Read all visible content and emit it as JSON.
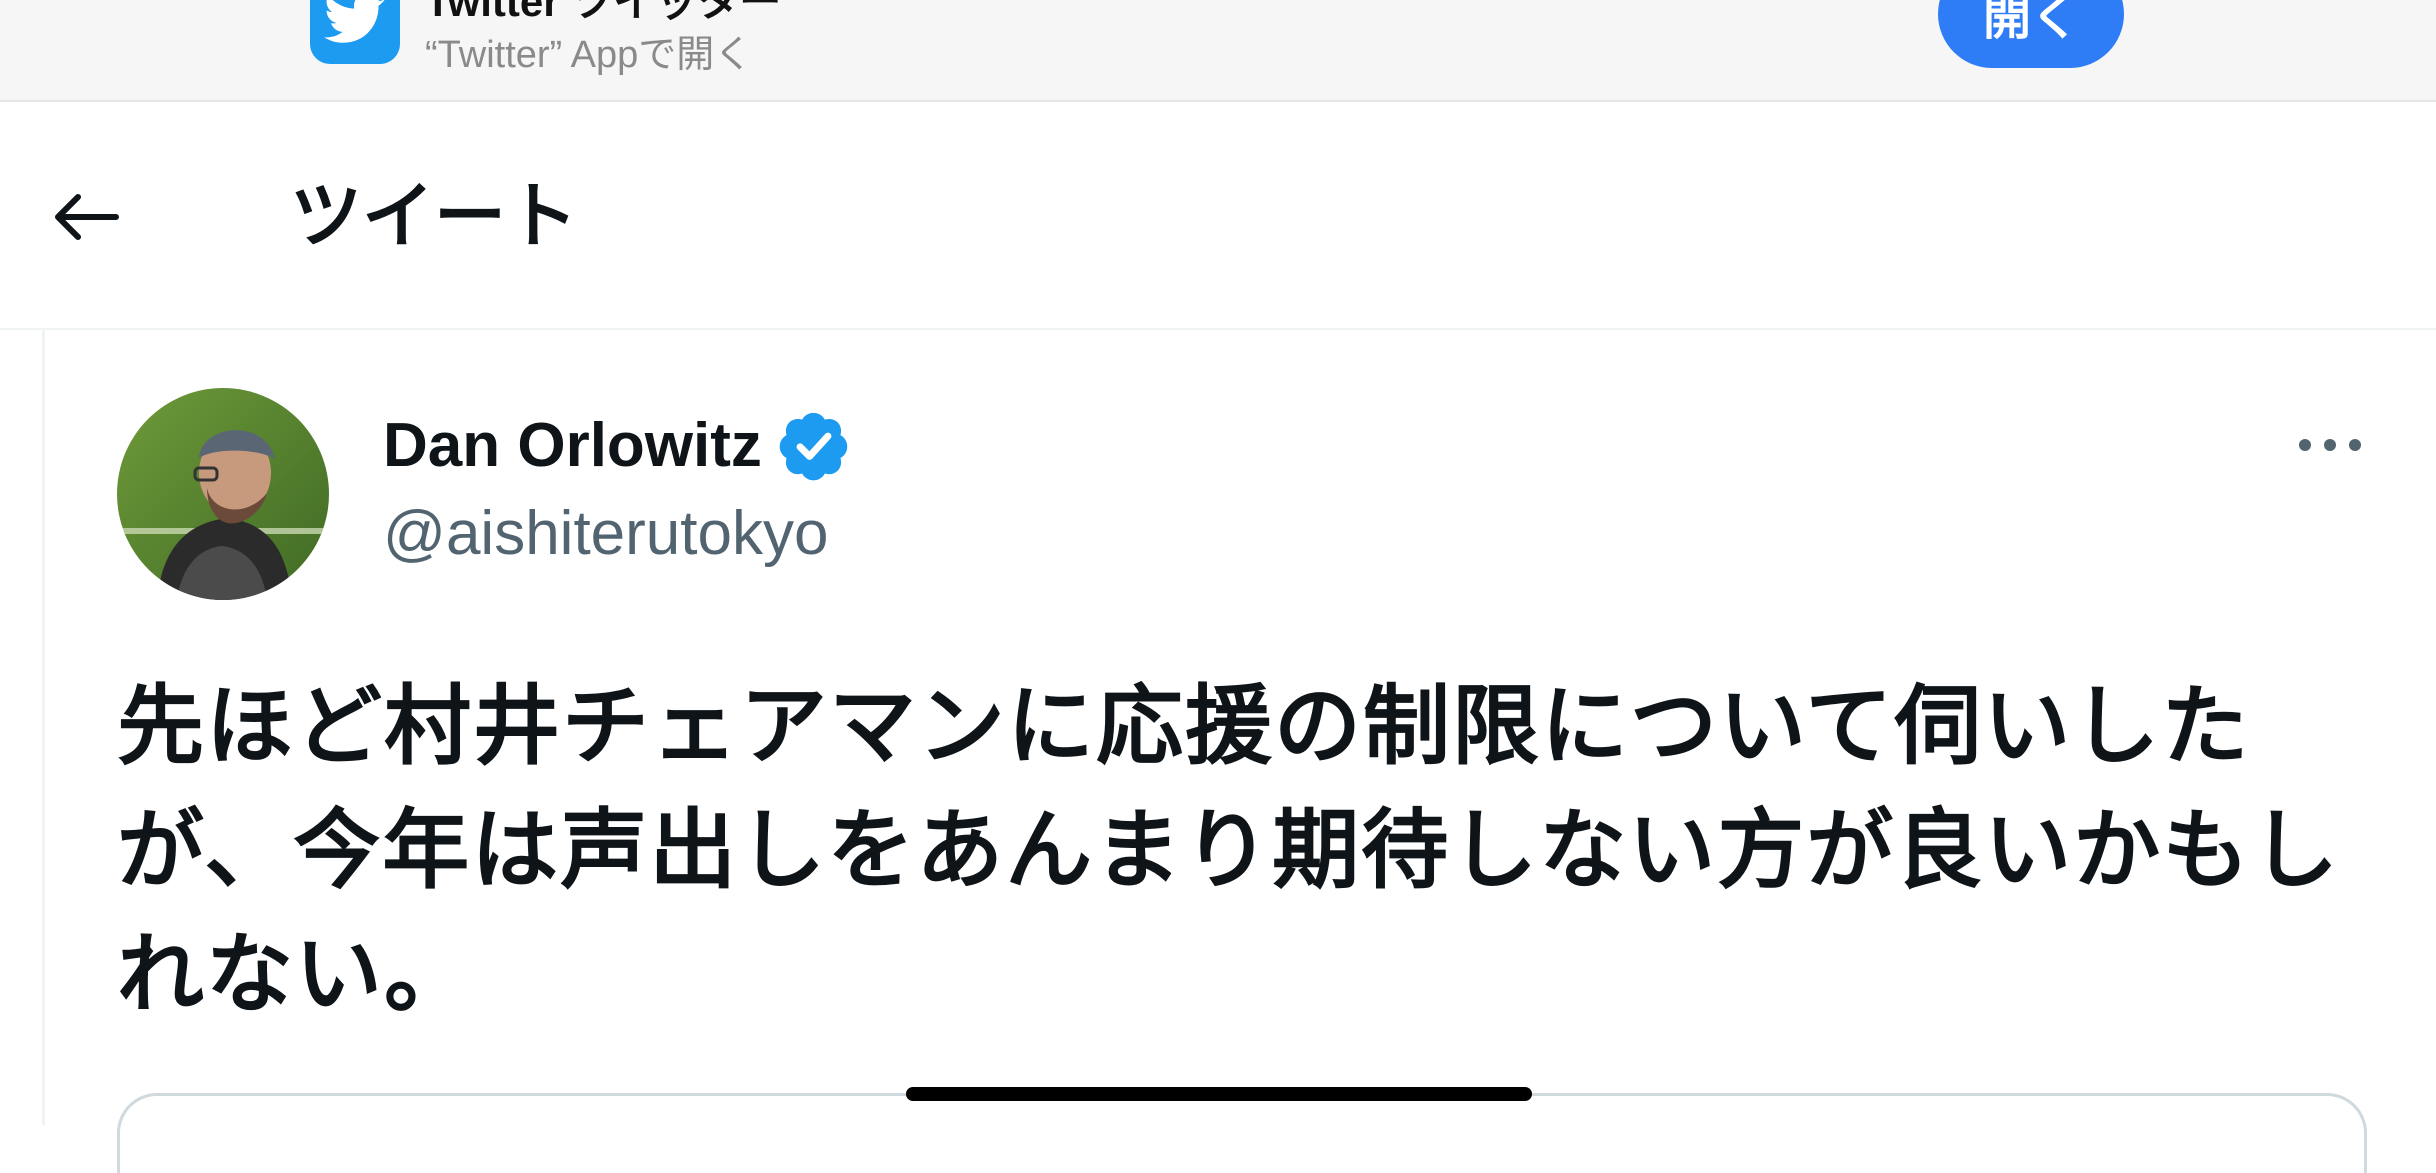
{
  "app_banner": {
    "app_name": "Twitter ツイッター",
    "subtitle": "“Twitter” Appで開く",
    "open_label": "開く",
    "icon": "twitter-bird-icon",
    "accent_color": "#2f7df6"
  },
  "header": {
    "title": "ツイート",
    "back_icon": "arrow-left-icon"
  },
  "tweet": {
    "author_name": "Dan Orlowitz",
    "author_handle": "@aishiterutokyo",
    "verified": true,
    "verified_color": "#1d9bf0",
    "more_icon": "more-horizontal-icon",
    "text": "先ほど村井チェアマンに応援の制限について伺いしたが、今年は声出しをあんまり期待しない方が良いかもしれない。"
  }
}
